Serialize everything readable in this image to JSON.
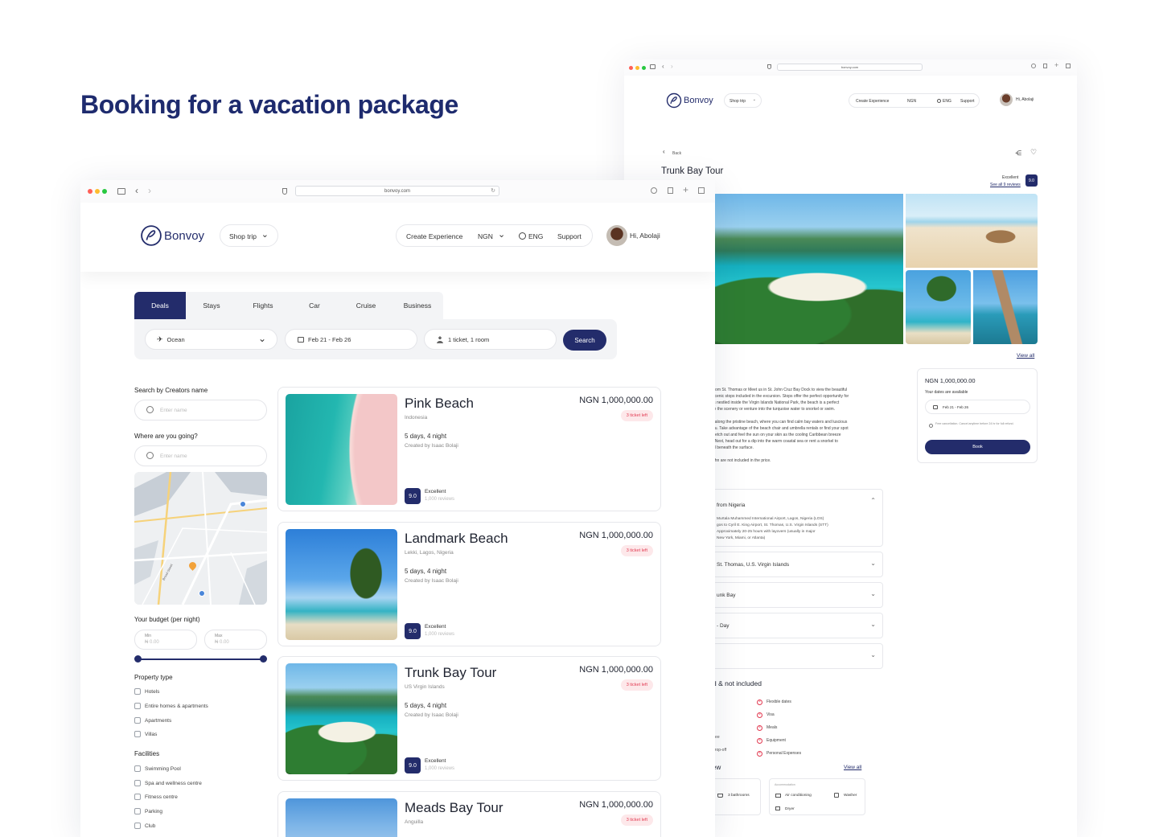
{
  "page": {
    "headline": "Booking for a vacation package"
  },
  "colors": {
    "brand": "#232c6b",
    "accent_red": "#e23b52",
    "headline": "#1e2b6e"
  },
  "browser": {
    "url": "bonvoy.com"
  },
  "nav": {
    "logo": "Bonvoy",
    "shop_trip": "Shop trip",
    "create_experience": "Create Experience",
    "currency": "NGN",
    "language": "ENG",
    "support": "Support",
    "greeting": "Hi, Abolaji"
  },
  "search": {
    "tabs": [
      "Deals",
      "Stays",
      "Flights",
      "Car",
      "Cruise",
      "Business"
    ],
    "destination": "Ocean",
    "dates": "Feb 21 - Feb 26",
    "guests": "1 ticket, 1 room",
    "button": "Search"
  },
  "filters": {
    "creator_label": "Search by Creators name",
    "creator_placeholder": "Enter name",
    "where_label": "Where are you going?",
    "where_placeholder": "Enter name",
    "budget_label": "Your budget (per night)",
    "min_label": "Min",
    "min_value": "₦ 0.00",
    "max_label": "Max",
    "max_value": "₦ 0.00",
    "property_label": "Property type",
    "property_types": [
      "Hotels",
      "Entire homes & apartments",
      "Apartments",
      "Villas"
    ],
    "facilities_label": "Facilities",
    "facilities": [
      "Swimming Pool",
      "Spa and wellness centre",
      "Fitness centre",
      "Parking",
      "Club"
    ],
    "map_street": "Broad Street"
  },
  "results": [
    {
      "title": "Pink Beach",
      "location": "Indonesia",
      "duration": "5 days, 4 night",
      "creator": "Created by Isaac Bolaji",
      "price": "NGN 1,000,000.00",
      "badge": "3 ticket left",
      "score": "9.0",
      "rating": "Excellent",
      "reviews": "1,000 reviews"
    },
    {
      "title": "Landmark Beach",
      "location": "Lekki, Lagos, Nigeria",
      "duration": "5 days, 4 night",
      "creator": "Created by Isaac Bolaji",
      "price": "NGN 1,000,000.00",
      "badge": "3 ticket left",
      "score": "9.0",
      "rating": "Excellent",
      "reviews": "1,000 reviews"
    },
    {
      "title": "Trunk Bay Tour",
      "location": "US Virgin Islands",
      "duration": "5 days, 4 night",
      "creator": "Created by Isaac Bolaji",
      "price": "NGN 1,000,000.00",
      "badge": "3 ticket left",
      "score": "9.0",
      "rating": "Excellent",
      "reviews": "1,000 reviews"
    },
    {
      "title": "Meads Bay Tour",
      "location": "Anguilla",
      "price": "NGN 1,000,000.00",
      "badge": "3 ticket left"
    }
  ],
  "detail": {
    "back": "Back",
    "title": "Trunk Bay Tour",
    "rating": "Excellent",
    "score": "9.0",
    "see_reviews": "See all 9 reviews",
    "view_all": "View all",
    "price": "NGN 1,000,000.00",
    "availability": "Your dates are available",
    "dates": "Feb 21 - Feb 26",
    "cancellation": "Free cancellation. Cancel anytime before 24 hr for full refund.",
    "book": "Book",
    "description": [
      "from St. Thomas or Meet us in St. John Cruz Bay Dock to view the beautiful",
      "scenic stops included in the excursion. Stops offer the perfect opportunity for",
      "is nestled inside the Virgin Islands National Park, the beach is a perfect",
      "re the scenery or venture into the turquoise water to snorkel or swim.",
      "",
      "f along the pristine beach, where you can find calm bay waters and luscious",
      "ou. Take advantage of the beach chair and umbrella rentals or find your spot",
      "tretch out and feel the sun on your skin as the cooling Caribbean breeze",
      ". Next, head out for a dip into the warm coastal sea or rent a snorkel to",
      "al beneath the surface.",
      "",
      "ohn are not included in the price."
    ],
    "itinerary": [
      {
        "title": "from Nigeria",
        "lines": [
          "Murtala Muhammed International Airport, Lagos, Nigeria (LOS)",
          "gos to Cyril E. King Airport, St. Thomas, U.S. Virgin Islands (STT)",
          "Approximately 20-25 hours with layovers (usually in major",
          "New York, Miami, or Atlanta)"
        ]
      },
      {
        "title": "St. Thomas, U.S. Virgin Islands"
      },
      {
        "title": "unk Bay"
      },
      {
        "title": "- Day"
      },
      {
        "title": ""
      }
    ],
    "included_title": "d & not included",
    "included_left": [
      "Fee",
      "drop-off"
    ],
    "not_included": [
      "Flexible dates",
      "Visa",
      "Meals",
      "Equipment",
      "Personal Expenses"
    ],
    "overview_tail": "ew",
    "overview_view_all": "View all",
    "bathrooms": "3 bathrooms",
    "accommodation_label": "Accommodation",
    "amenities": [
      "Air conditioning",
      "Washer",
      "Dryer"
    ]
  }
}
